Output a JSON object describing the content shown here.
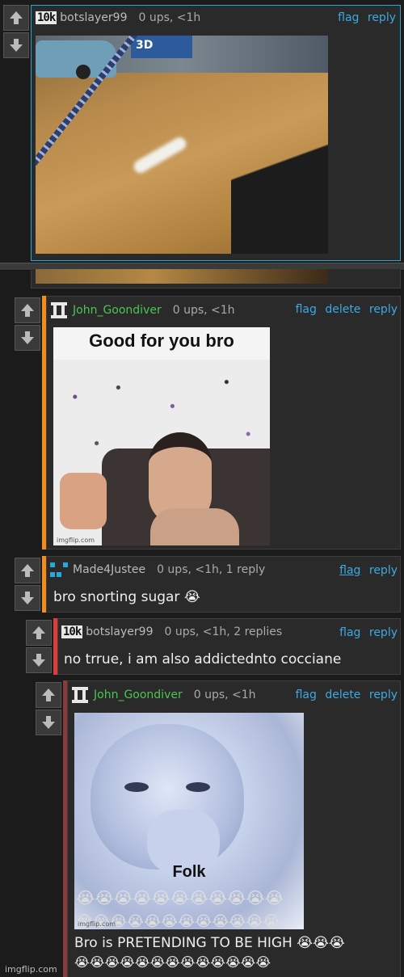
{
  "comments": [
    {
      "badge": "10k",
      "username": "botslayer99",
      "meta": "0 ups, <1h",
      "actions": [
        "flag",
        "reply"
      ]
    },
    {
      "username": "John_Goondiver",
      "meta": "0 ups, <1h",
      "actions": [
        "flag",
        "delete",
        "reply"
      ],
      "image_caption": "Good for you bro",
      "image_watermark": "imgflip.com"
    },
    {
      "username": "Made4Justee",
      "meta": "0 ups, <1h, 1 reply",
      "actions": [
        "flag",
        "reply"
      ],
      "text": "bro snorting sugar 😭"
    },
    {
      "badge": "10k",
      "username": "botslayer99",
      "meta": "0 ups, <1h, 2 replies",
      "actions": [
        "flag",
        "reply"
      ],
      "text": "no trrue, i am also addictednto cocciane"
    },
    {
      "username": "John_Goondiver",
      "meta": "0 ups, <1h",
      "actions": [
        "flag",
        "delete",
        "reply"
      ],
      "image_caption": "Folk",
      "image_emojis_1": "😭😭😭😭😭😭😭😭😭😭😭",
      "image_emojis_2": "😭😭😭😭😭😭😭😭😭😭😭😭",
      "image_watermark": "imgflip.com",
      "text_line1": "Bro is PRETENDING TO BE HIGH 😭😭😭",
      "text_line2": "😭😭😭😭😭😭😭😭😭😭😭😭😭"
    }
  ],
  "box_label": "3D",
  "footer": "imgflip.com",
  "colors": {
    "accent_link": "#3da9e3",
    "username_green": "#4cc552",
    "bar_orange": "#f28c1e",
    "bar_red": "#e03b3b",
    "bar_darkred": "#8a3a3a",
    "highlight_border": "#2aa6d9"
  }
}
